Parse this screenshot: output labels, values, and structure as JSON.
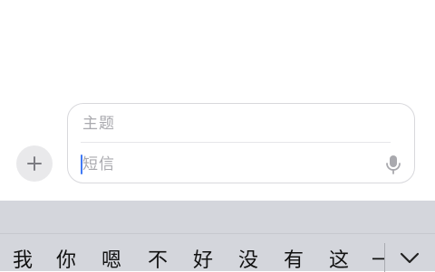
{
  "composer": {
    "subject_placeholder": "主题",
    "message_placeholder": "短信"
  },
  "keyboard": {
    "candidates": [
      "我",
      "你",
      "嗯",
      "不",
      "好",
      "没",
      "有",
      "这",
      "一"
    ]
  },
  "colors": {
    "accent_cursor": "#3f79f5",
    "placeholder": "#a9a9ae",
    "keyboard_bg": "#d4d6dc"
  },
  "icons": {
    "add": "plus-icon",
    "mic": "microphone-icon",
    "expand": "chevron-down-icon"
  }
}
